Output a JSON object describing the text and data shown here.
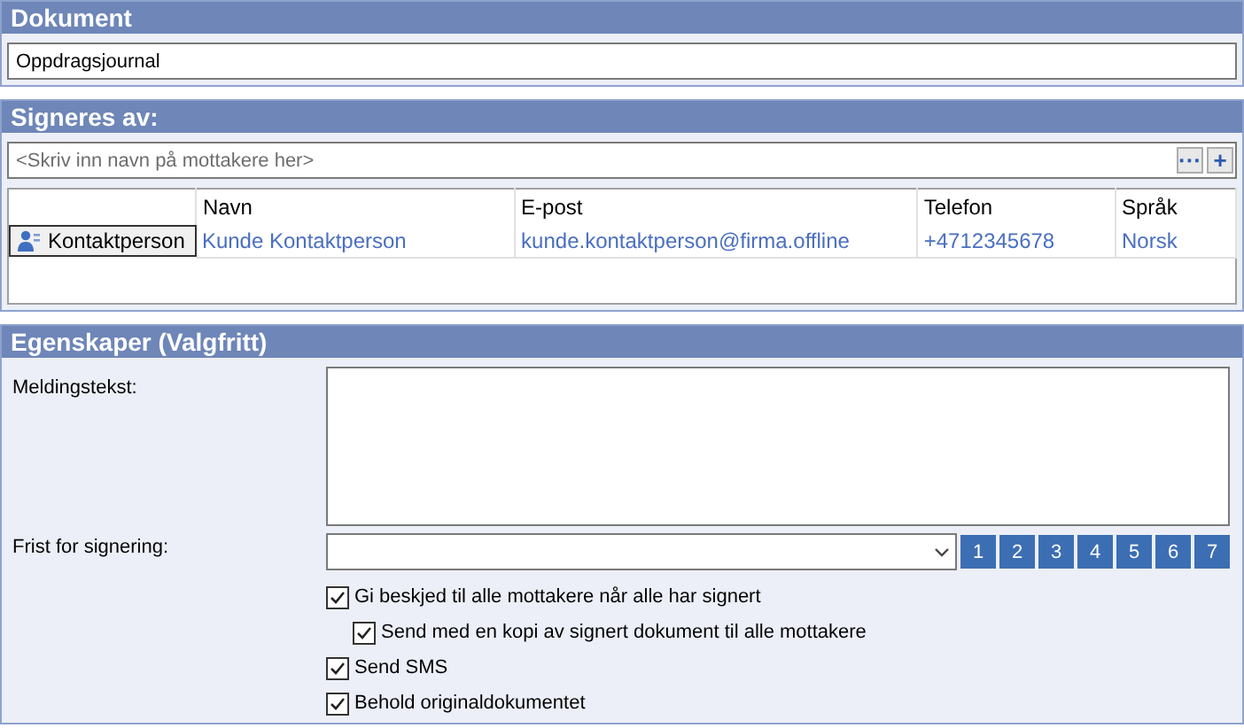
{
  "document_panel": {
    "title": "Dokument",
    "document_field": {
      "value": "Oppdragsjournal"
    }
  },
  "signers_panel": {
    "title": "Signeres av:",
    "recipient_field": {
      "placeholder": "<Skriv inn navn på mottakere her>"
    },
    "browse_button": "···",
    "add_button": "+",
    "table": {
      "columns": [
        "Navn",
        "E-post",
        "Telefon",
        "Språk"
      ],
      "rows": [
        {
          "role": "Kontaktperson",
          "cells": [
            "Kunde Kontaktperson",
            "kunde.kontaktperson@firma.offline",
            "+4712345678",
            "Norsk"
          ]
        }
      ]
    }
  },
  "properties_panel": {
    "title": "Egenskaper (Valgfritt)",
    "message_label": "Meldingstekst:",
    "deadline_label": "Frist for signering:",
    "day_buttons": [
      "1",
      "2",
      "3",
      "4",
      "5",
      "6",
      "7"
    ],
    "options": [
      {
        "label": "Gi beskjed til alle mottakere når alle har signert",
        "checked": true,
        "children": [
          {
            "label": "Send med en kopi av signert dokument til alle mottakere",
            "checked": true
          }
        ]
      },
      {
        "label": "Send SMS",
        "checked": true
      },
      {
        "label": "Behold originaldokumentet",
        "checked": true
      }
    ]
  }
}
